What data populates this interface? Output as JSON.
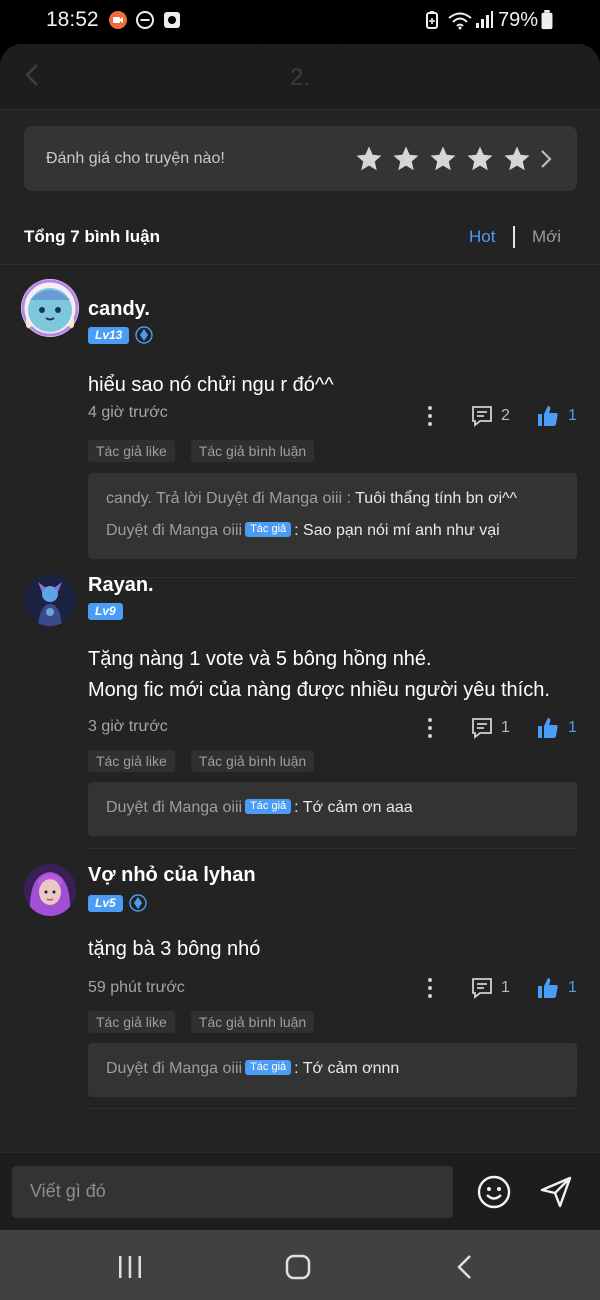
{
  "status_bar": {
    "time": "18:52",
    "battery": "79%",
    "icons": [
      "recording-icon",
      "do-not-disturb-icon",
      "app-notification-icon",
      "battery-saver-icon",
      "wifi-icon",
      "signal-icon",
      "battery-icon"
    ]
  },
  "header": {
    "title": "2.",
    "back_icon": "chevron-left-icon"
  },
  "rating": {
    "prompt": "Đánh giá cho truyện nào!",
    "stars_total": 5,
    "stars_filled": 0
  },
  "comments_header": {
    "total": "Tổng 7 bình luận",
    "sort_hot": "Hot",
    "sort_new": "Mới",
    "active_sort": "Hot"
  },
  "comments": [
    {
      "username": "candy.",
      "level": "Lv13",
      "content": "hiểu sao nó chửi ngu r đó^^",
      "time": "4 giờ trước",
      "reply_count": "2",
      "like_count": "1",
      "tags": [
        "Tác giả like",
        "Tác giả bình luận"
      ],
      "replies": [
        {
          "prefix": "candy. Trả lời Duyệt đi Manga oiii : ",
          "badge": "",
          "message": "Tuôi thẩng tính bn ơi^^"
        },
        {
          "prefix": "Duyệt đi Manga oiii",
          "badge": "Tác giả",
          "message": ": Sao pạn nói mí anh như vại"
        }
      ]
    },
    {
      "username": "Rayan.",
      "level": "Lv9",
      "content_lines": [
        "Tặng nàng 1 vote và 5 bông hồng nhé.",
        "Mong fic mới của nàng được nhiều người yêu thích."
      ],
      "time": "3 giờ trước",
      "reply_count": "1",
      "like_count": "1",
      "tags": [
        "Tác giả like",
        "Tác giả bình luận"
      ],
      "replies": [
        {
          "prefix": "Duyệt đi Manga oiii",
          "badge": "Tác giả",
          "message": ": Tớ cảm ơn aaa"
        }
      ]
    },
    {
      "username": "Vợ nhỏ của lyhan",
      "level": "Lv5",
      "content": "tặng bà 3 bông nhó",
      "time": "59 phút trước",
      "reply_count": "1",
      "like_count": "1",
      "tags": [
        "Tác giả like",
        "Tác giả bình luận"
      ],
      "replies": [
        {
          "prefix": "Duyệt đi Manga oiii",
          "badge": "Tác giả",
          "message": ": Tớ cảm ơnnn"
        }
      ]
    }
  ],
  "input": {
    "placeholder": "Viết gì đó"
  },
  "colors": {
    "accent": "#4b9cf5",
    "background": "#232323",
    "card": "#333333"
  }
}
